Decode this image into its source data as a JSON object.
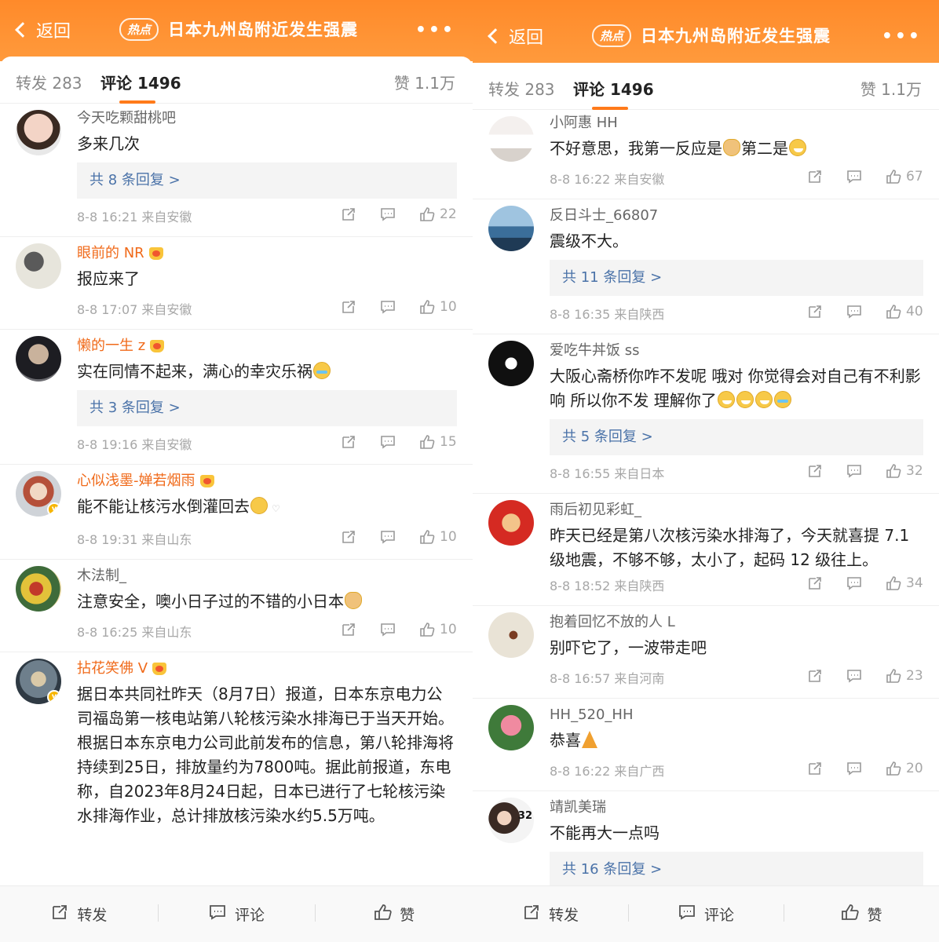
{
  "left": {
    "header": {
      "back_label": "返回",
      "hot_badge": "热点",
      "title": "日本九州岛附近发生强震",
      "more": "•••"
    },
    "tabs": {
      "repost": "转发 283",
      "comment": "评论 1496",
      "likes": "赞 1.1万"
    },
    "comments": [
      {
        "user": "今天吃颗甜桃吧",
        "text": "多来几次",
        "replies": "共 8 条回复 >",
        "time": "8-8 16:21  来自安徽",
        "likes": "22"
      },
      {
        "user": "眼前的 NR",
        "text": "报应来了",
        "time": "8-8 17:07  来自安徽",
        "likes": "10"
      },
      {
        "user": "懒的一生 z",
        "text": "实在同情不起来，满心的幸灾乐祸",
        "replies": "共 3 条回复 >",
        "time": "8-8 19:16  来自安徽",
        "likes": "15"
      },
      {
        "user": "心似浅墨-婵若烟雨",
        "text": "能不能让核污水倒灌回去",
        "time": "8-8 19:31  来自山东",
        "likes": "10"
      },
      {
        "user": "木法制_",
        "text": "注意安全，噢小日子过的不错的小日本",
        "time": "8-8 16:25  来自山东",
        "likes": "10"
      },
      {
        "user": "拈花笑佛 V",
        "text": "据日本共同社昨天（8月7日）报道，日本东京电力公司福岛第一核电站第八轮核污染水排海已于当天开始。根据日本东京电力公司此前发布的信息，第八轮排海将持续到25日，排放量约为7800吨。据此前报道，东电称，自2023年8月24日起，日本已进行了七轮核污染水排海作业，总计排放核污染水约5.5万吨。"
      }
    ],
    "bottom": {
      "repost": "转发",
      "comment": "评论",
      "like": "赞"
    }
  },
  "right": {
    "header": {
      "back_label": "返回",
      "hot_badge": "热点",
      "title": "日本九州岛附近发生强震",
      "more": "•••"
    },
    "tabs": {
      "repost": "转发 283",
      "comment": "评论 1496",
      "likes": "赞 1.1万"
    },
    "comments": [
      {
        "user": "小阿惠 HH",
        "text_a": "不好意思，我第一反应是",
        "text_b": "第二是",
        "time": "8-8 16:22  来自安徽",
        "likes": "67"
      },
      {
        "user": "反日斗士_66807",
        "text": "震级不大。",
        "replies": "共 11 条回复 >",
        "time": "8-8 16:35  来自陕西",
        "likes": "40"
      },
      {
        "user": "爱吃牛丼饭 ss",
        "text": "大阪心斋桥你咋不发呢 哦对 你觉得会对自己有不利影响 所以你不发 理解你了",
        "replies": "共 5 条回复 >",
        "time": "8-8 16:55  来自日本",
        "likes": "32"
      },
      {
        "user": "雨后初见彩虹_",
        "text": "昨天已经是第八次核污染水排海了，今天就喜提 7.1 级地震，不够不够，太小了，起码 12 级往上。",
        "time": "8-8 18:52  来自陕西",
        "likes": "34"
      },
      {
        "user": "抱着回忆不放的人 L",
        "text": "别吓它了，一波带走吧",
        "time": "8-8 16:57  来自河南",
        "likes": "23"
      },
      {
        "user": "HH_520_HH",
        "text": "恭喜",
        "time": "8-8 16:22  来自广西",
        "likes": "20"
      },
      {
        "user": "靖凯美瑞",
        "text": "不能再大一点吗",
        "replies": "共 16 条回复 >",
        "avatar_badge": "32"
      }
    ],
    "bottom": {
      "repost": "转发",
      "comment": "评论",
      "like": "赞"
    }
  },
  "colors": {
    "header_orange": "#ff8a2a",
    "vip_name": "#f06a1a",
    "reply_link": "#4a72a8",
    "tab_underline": "#ff7a1a"
  }
}
